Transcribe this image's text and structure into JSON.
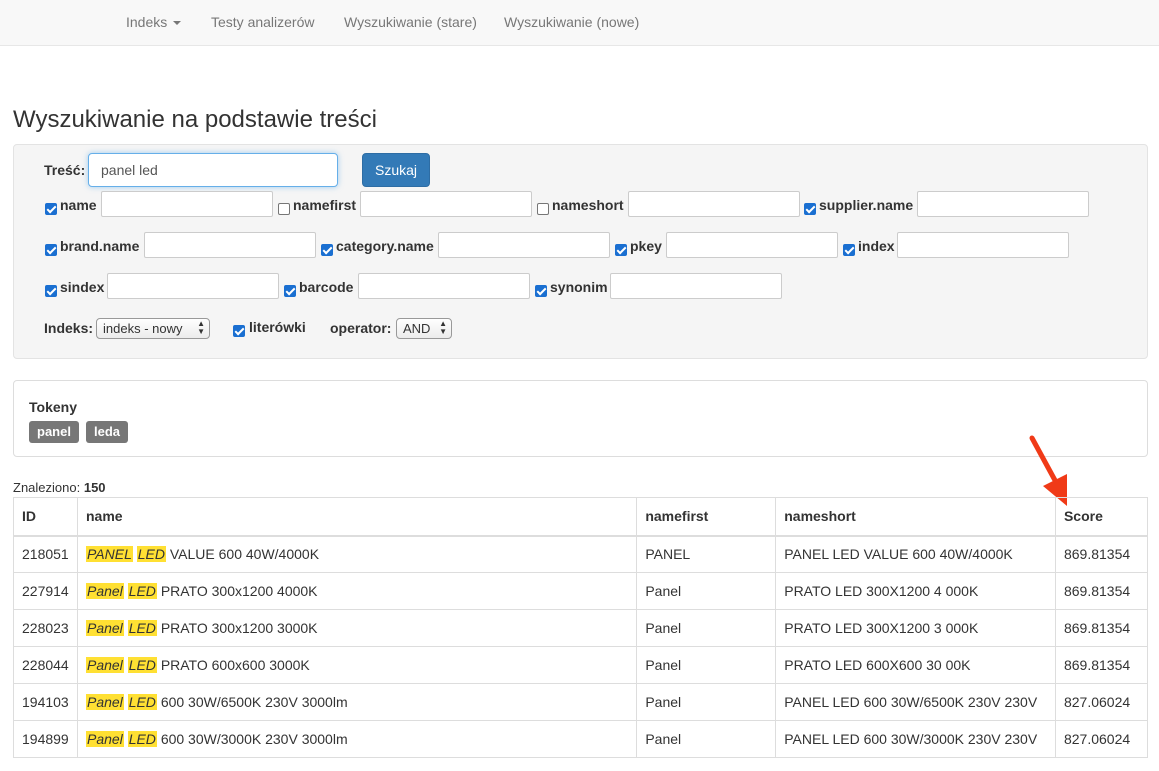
{
  "nav": {
    "items": [
      "Indeks",
      "Testy analizerów",
      "Wyszukiwanie (stare)",
      "Wyszukiwanie (nowe)"
    ]
  },
  "page": {
    "title": "Wyszukiwanie na podstawie treści"
  },
  "form": {
    "query_label": "Treść:",
    "query_value": "panel led",
    "search_button": "Szukaj",
    "fields": [
      {
        "label": "name",
        "checked": true
      },
      {
        "label": "namefirst",
        "checked": false
      },
      {
        "label": "nameshort",
        "checked": false
      },
      {
        "label": "supplier.name",
        "checked": true
      },
      {
        "label": "brand.name",
        "checked": true
      },
      {
        "label": "category.name",
        "checked": true
      },
      {
        "label": "pkey",
        "checked": true
      },
      {
        "label": "index",
        "checked": true
      },
      {
        "label": "sindex",
        "checked": true
      },
      {
        "label": "barcode",
        "checked": true
      },
      {
        "label": "synonim",
        "checked": true
      }
    ],
    "index_label": "Indeks:",
    "index_value": "indeks - nowy",
    "typos_label": "literówki",
    "typos_checked": true,
    "operator_label": "operator:",
    "operator_value": "AND"
  },
  "tokens": {
    "title": "Tokeny",
    "items": [
      "panel",
      "leda"
    ]
  },
  "results": {
    "found_label": "Znaleziono:",
    "found_count": "150",
    "columns": [
      "ID",
      "name",
      "namefirst",
      "nameshort",
      "Score"
    ],
    "rows": [
      {
        "id": "218051",
        "hl1": "PANEL",
        "hl2": "LED",
        "rest": "VALUE 600 40W/4000K",
        "namefirst": "PANEL",
        "nameshort": "PANEL LED VALUE 600 40W/4000K",
        "score": "869.81354"
      },
      {
        "id": "227914",
        "hl1": "Panel",
        "hl2": "LED",
        "rest": "PRATO 300x1200 4000K",
        "namefirst": "Panel",
        "nameshort": "PRATO LED 300X1200 4 000K",
        "score": "869.81354"
      },
      {
        "id": "228023",
        "hl1": "Panel",
        "hl2": "LED",
        "rest": "PRATO 300x1200 3000K",
        "namefirst": "Panel",
        "nameshort": "PRATO LED 300X1200 3 000K",
        "score": "869.81354"
      },
      {
        "id": "228044",
        "hl1": "Panel",
        "hl2": "LED",
        "rest": "PRATO 600x600 3000K",
        "namefirst": "Panel",
        "nameshort": "PRATO LED 600X600 30 00K",
        "score": "869.81354"
      },
      {
        "id": "194103",
        "hl1": "Panel",
        "hl2": "LED",
        "rest": "600 30W/6500K 230V 3000lm",
        "namefirst": "Panel",
        "nameshort": "PANEL LED 600 30W/6500K 230V 230V",
        "score": "827.06024"
      },
      {
        "id": "194899",
        "hl1": "Panel",
        "hl2": "LED",
        "rest": "600 30W/3000K 230V 3000lm",
        "namefirst": "Panel",
        "nameshort": "PANEL LED 600 30W/3000K 230V 230V",
        "score": "827.06024"
      }
    ]
  },
  "colors": {
    "primary": "#337ab7",
    "highlight": "#ffe033",
    "arrow": "#f03a17",
    "badge": "#777777"
  }
}
